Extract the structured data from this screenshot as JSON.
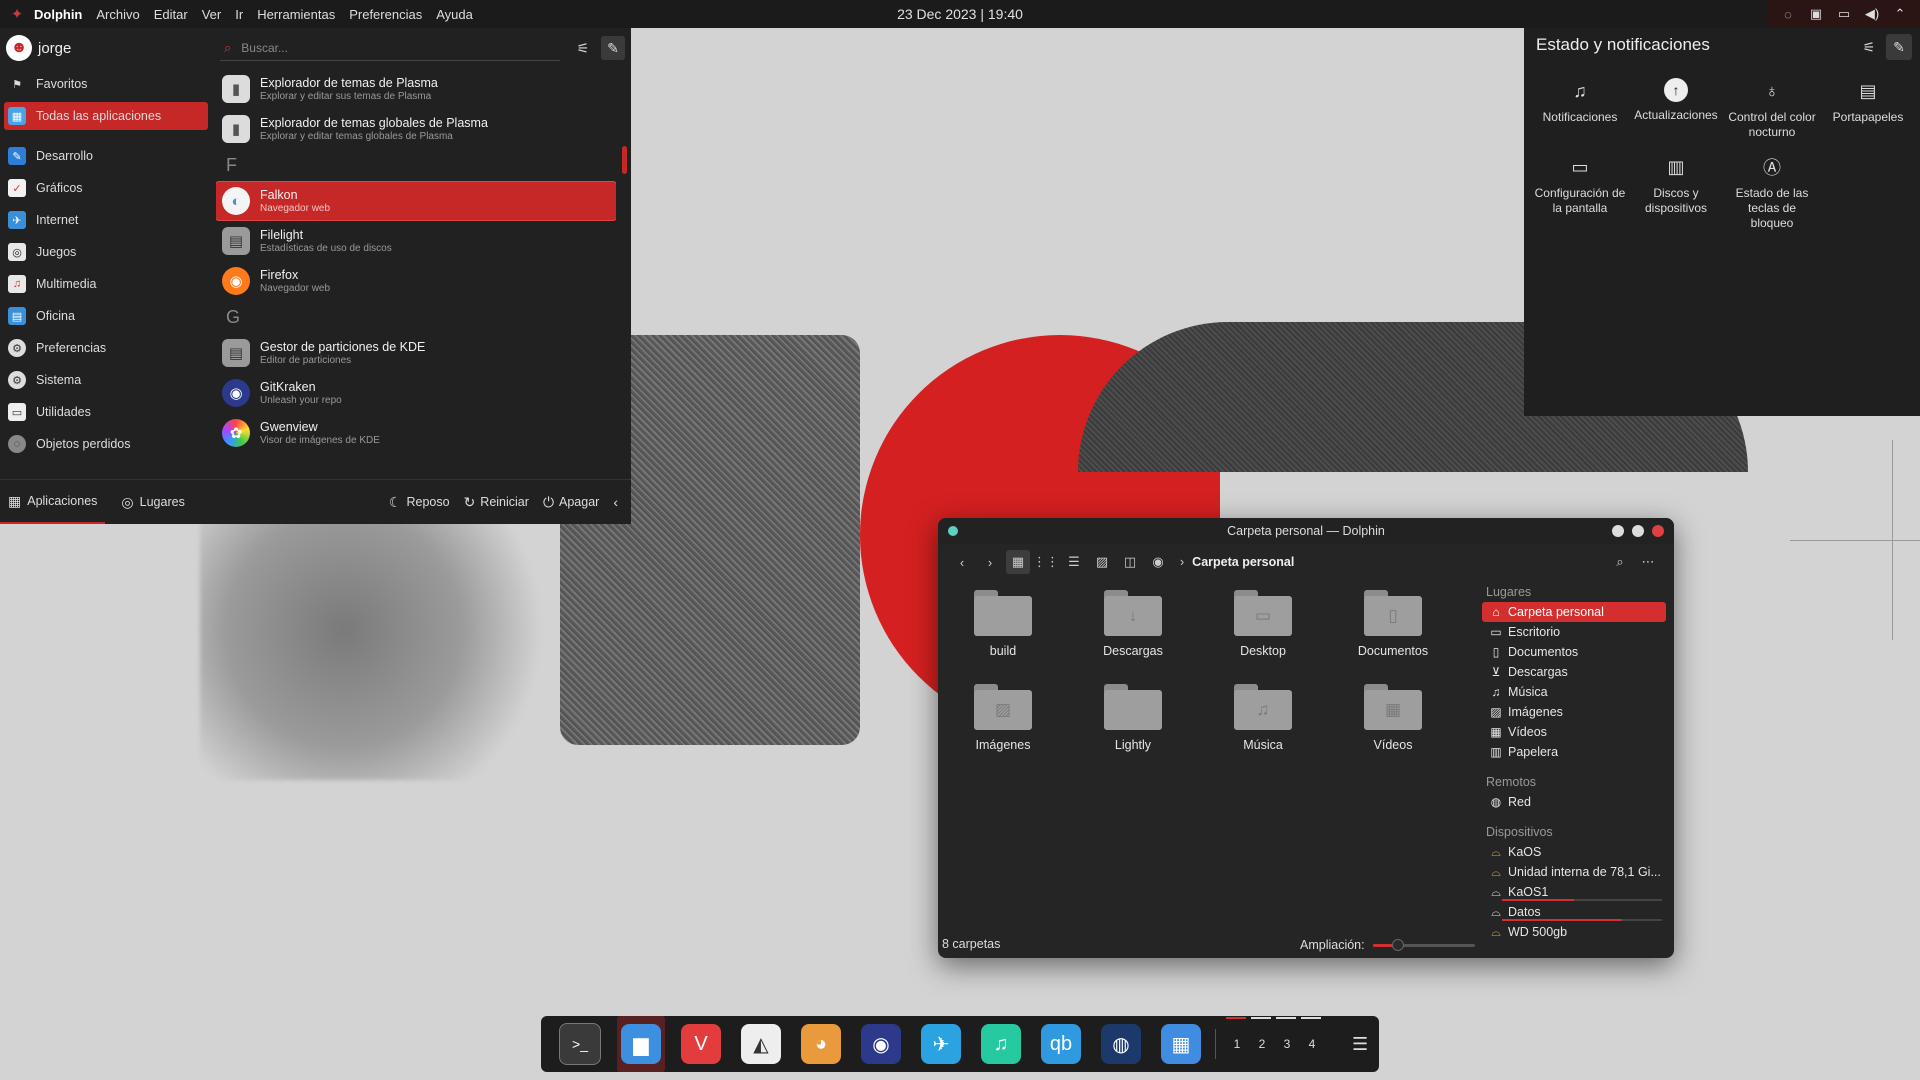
{
  "topbar": {
    "app_name": "Dolphin",
    "menus": [
      "Archivo",
      "Editar",
      "Ver",
      "Ir",
      "Herramientas",
      "Preferencias",
      "Ayuda"
    ],
    "clock": "23 Dec 2023 | 19:40"
  },
  "launcher": {
    "user": "jorge",
    "search_placeholder": "Buscar...",
    "categories": [
      {
        "label": "Favoritos",
        "icon": "bookmark-icon"
      },
      {
        "label": "Todas las aplicaciones",
        "icon": "grid-icon"
      },
      {
        "label": "Desarrollo",
        "icon": "development-icon"
      },
      {
        "label": "Gráficos",
        "icon": "graphics-icon"
      },
      {
        "label": "Internet",
        "icon": "internet-icon"
      },
      {
        "label": "Juegos",
        "icon": "gamepad-icon"
      },
      {
        "label": "Multimedia",
        "icon": "multimedia-icon"
      },
      {
        "label": "Oficina",
        "icon": "office-icon"
      },
      {
        "label": "Preferencias",
        "icon": "settings-icon"
      },
      {
        "label": "Sistema",
        "icon": "system-icon"
      },
      {
        "label": "Utilidades",
        "icon": "utilities-icon"
      },
      {
        "label": "Objetos perdidos",
        "icon": "lost-found-icon"
      }
    ],
    "apps": [
      {
        "name": "Explorador de temas de Plasma",
        "desc": "Explorar y editar sus temas de Plasma"
      },
      {
        "name": "Explorador de temas globales de Plasma",
        "desc": "Explorar y editar temas globales de Plasma"
      },
      {
        "name": "Falkon",
        "desc": "Navegador web"
      },
      {
        "name": "Filelight",
        "desc": "Estadísticas de uso de discos"
      },
      {
        "name": "Firefox",
        "desc": "Navegador web"
      },
      {
        "name": "Gestor de particiones de KDE",
        "desc": "Editor de particiones"
      },
      {
        "name": "GitKraken",
        "desc": "Unleash your repo"
      },
      {
        "name": "Gwenview",
        "desc": "Visor de imágenes de KDE"
      }
    ],
    "letters": {
      "f": "F",
      "g": "G"
    },
    "footer": {
      "tab_apps": "Aplicaciones",
      "tab_places": "Lugares",
      "sleep": "Reposo",
      "restart": "Reiniciar",
      "shutdown": "Apagar"
    }
  },
  "status_panel": {
    "title": "Estado y notificaciones",
    "items": [
      {
        "label": "Notificaciones",
        "icon": "bell-icon"
      },
      {
        "label": "Actualizaciones",
        "icon": "update-icon"
      },
      {
        "label": "Control del color nocturno",
        "icon": "night-color-icon"
      },
      {
        "label": "Portapapeles",
        "icon": "clipboard-icon"
      },
      {
        "label": "Configuración de la pantalla",
        "icon": "display-icon"
      },
      {
        "label": "Discos y dispositivos",
        "icon": "disks-icon"
      },
      {
        "label": "Estado de las teclas de bloqueo",
        "icon": "keyboard-lock-icon"
      }
    ]
  },
  "dolphin": {
    "title": "Carpeta personal — Dolphin",
    "breadcrumb": "Carpeta personal",
    "folders": [
      {
        "name": "build",
        "glyph": ""
      },
      {
        "name": "Descargas",
        "glyph": "↓"
      },
      {
        "name": "Desktop",
        "glyph": "▭"
      },
      {
        "name": "Documentos",
        "glyph": "▯"
      },
      {
        "name": "Imágenes",
        "glyph": "▨"
      },
      {
        "name": "Lightly",
        "glyph": ""
      },
      {
        "name": "Música",
        "glyph": "♫"
      },
      {
        "name": "Vídeos",
        "glyph": "▦"
      }
    ],
    "places": {
      "heading_places": "Lugares",
      "places": [
        "Carpeta personal",
        "Escritorio",
        "Documentos",
        "Descargas",
        "Música",
        "Imágenes",
        "Vídeos",
        "Papelera"
      ],
      "heading_remote": "Remotos",
      "remote": [
        "Red"
      ],
      "heading_devices": "Dispositivos",
      "devices": [
        {
          "label": "KaOS",
          "usage": null
        },
        {
          "label": "Unidad interna de 78,1 Gi...",
          "usage": null
        },
        {
          "label": "KaOS1",
          "usage": 0.45
        },
        {
          "label": "Datos",
          "usage": 0.75
        },
        {
          "label": "WD 500gb",
          "usage": null
        }
      ]
    },
    "status": {
      "count": "8 carpetas",
      "zoom_label": "Ampliación:",
      "zoom_level": 0.25
    }
  },
  "dock": {
    "apps": [
      {
        "name": "terminal-icon",
        "glyph": ">_",
        "color": "#3a3a3a"
      },
      {
        "name": "dolphin-icon",
        "glyph": "▆",
        "color": "#3d8fe0"
      },
      {
        "name": "vivaldi-icon",
        "glyph": "V",
        "color": "#e23c3c"
      },
      {
        "name": "inkscape-icon",
        "glyph": "◭",
        "color": "#eeeeee"
      },
      {
        "name": "gimp-icon",
        "glyph": "◕",
        "color": "#e89a3c"
      },
      {
        "name": "gitkraken-icon",
        "glyph": "◉",
        "color": "#2d3a8c"
      },
      {
        "name": "telegram-icon",
        "glyph": "✈",
        "color": "#2aa3e0"
      },
      {
        "name": "elisa-music-icon",
        "glyph": "♫",
        "color": "#27c9a0"
      },
      {
        "name": "qbittorrent-icon",
        "glyph": "qb",
        "color": "#2f9ae0"
      },
      {
        "name": "steam-icon",
        "glyph": "◍",
        "color": "#1b3a6b"
      },
      {
        "name": "discover-store-icon",
        "glyph": "▦",
        "color": "#3f8ce0"
      }
    ],
    "desktops": [
      "1",
      "2",
      "3",
      "4"
    ]
  }
}
